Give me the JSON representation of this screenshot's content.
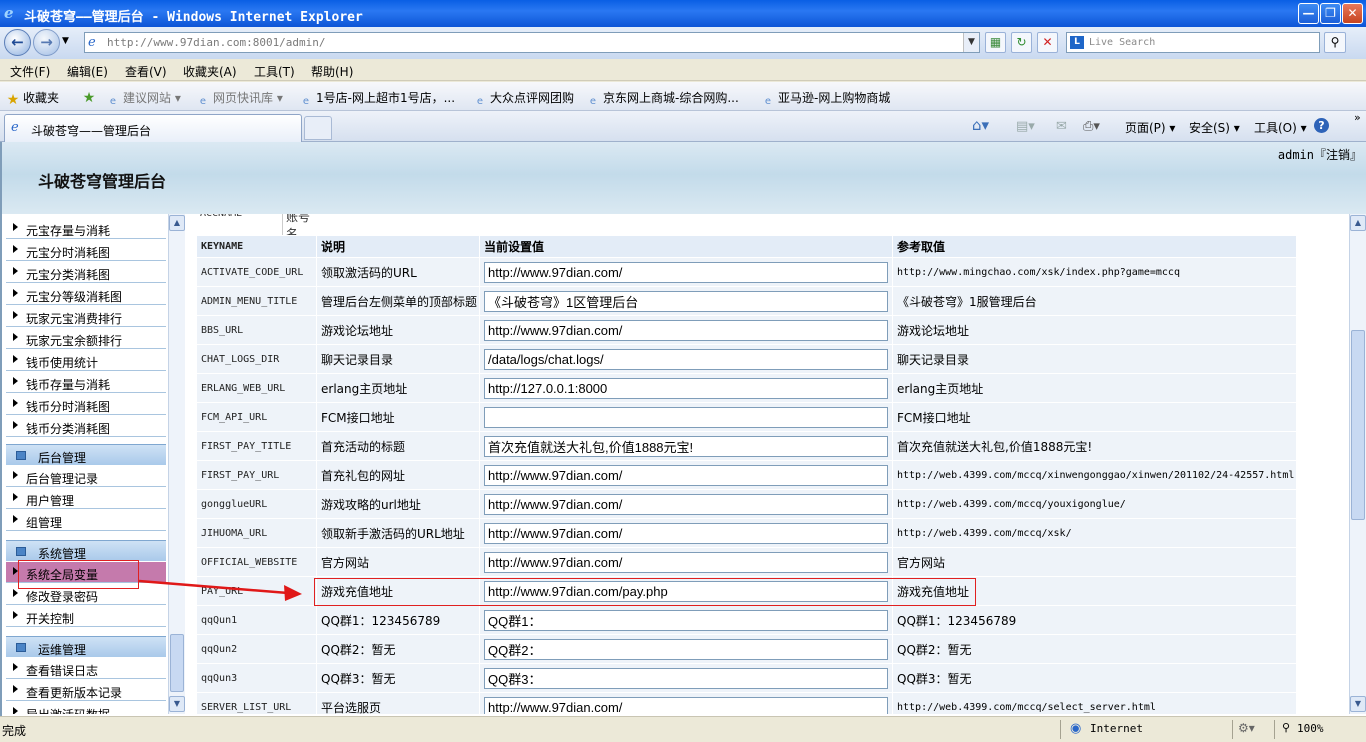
{
  "window": {
    "title": "斗破苍穹——管理后台 - Windows Internet Explorer"
  },
  "address_bar": {
    "url": "http://www.97dian.com:8001/admin/",
    "search_placeholder": "Live Search"
  },
  "menu": [
    "文件(F)",
    "编辑(E)",
    "查看(V)",
    "收藏夹(A)",
    "工具(T)",
    "帮助(H)"
  ],
  "favorites": {
    "label": "收藏夹",
    "items": [
      "建议网站 ▾",
      "网页快讯库 ▾",
      "1号店-网上超市1号店，...",
      "大众点评网团购",
      "京东网上商城-综合网购...",
      "亚马逊-网上购物商城"
    ]
  },
  "tab": {
    "title": "斗破苍穹——管理后台"
  },
  "command_bar": {
    "page": "页面(P) ▾",
    "safety": "安全(S) ▾",
    "tools": "工具(O) ▾"
  },
  "page": {
    "user": "admin『注销』",
    "title": "斗破苍穹管理后台"
  },
  "left_menu": {
    "items_a": [
      "元宝存量与消耗",
      "元宝分时消耗图",
      "元宝分类消耗图",
      "元宝分等级消耗图",
      "玩家元宝消费排行",
      "玩家元宝余额排行",
      "钱币使用统计",
      "钱币存量与消耗",
      "钱币分时消耗图",
      "钱币分类消耗图"
    ],
    "group_backend": "后台管理",
    "items_b": [
      "后台管理记录",
      "用户管理",
      "组管理"
    ],
    "group_system": "系统管理",
    "items_c": [
      "系统全局变量",
      "修改登录密码",
      "开关控制"
    ],
    "group_ops": "运维管理",
    "items_d": [
      "查看错误日志",
      "查看更新版本记录",
      "导出激活码数据"
    ]
  },
  "table": {
    "prev_row": {
      "key": "ACCNAME",
      "desc": "账号名"
    },
    "headers": {
      "key": "KEYNAME",
      "desc": "说明",
      "value": "当前设置值",
      "ref": "参考取值"
    },
    "rows": [
      {
        "key": "ACTIVATE_CODE_URL",
        "desc": "领取激活码的URL",
        "value": "http://www.97dian.com/",
        "ref": "http://www.mingchao.com/xsk/index.php?game=mccq"
      },
      {
        "key": "ADMIN_MENU_TITLE",
        "desc": "管理后台左侧菜单的顶部标题",
        "value": "《斗破苍穹》1区管理后台",
        "ref": "《斗破苍穹》1服管理后台"
      },
      {
        "key": "BBS_URL",
        "desc": "游戏论坛地址",
        "value": "http://www.97dian.com/",
        "ref": "游戏论坛地址"
      },
      {
        "key": "CHAT_LOGS_DIR",
        "desc": "聊天记录目录",
        "value": "/data/logs/chat.logs/",
        "ref": "聊天记录目录"
      },
      {
        "key": "ERLANG_WEB_URL",
        "desc": "erlang主页地址",
        "value": "http://127.0.0.1:8000",
        "ref": "erlang主页地址"
      },
      {
        "key": "FCM_API_URL",
        "desc": "FCM接口地址",
        "value": "",
        "ref": "FCM接口地址"
      },
      {
        "key": "FIRST_PAY_TITLE",
        "desc": "首充活动的标题",
        "value": "首次充值就送大礼包,价值1888元宝!",
        "ref": "首次充值就送大礼包,价值1888元宝!"
      },
      {
        "key": "FIRST_PAY_URL",
        "desc": "首充礼包的网址",
        "value": "http://www.97dian.com/",
        "ref": "http://web.4399.com/mccq/xinwengonggao/xinwen/201102/24-42557.html"
      },
      {
        "key": "gongglueURL",
        "desc": "游戏攻略的url地址",
        "value": "http://www.97dian.com/",
        "ref": "http://web.4399.com/mccq/youxigonglue/"
      },
      {
        "key": "JIHUOMA_URL",
        "desc": "领取新手激活码的URL地址",
        "value": "http://www.97dian.com/",
        "ref": "http://web.4399.com/mccq/xsk/"
      },
      {
        "key": "OFFICIAL_WEBSITE",
        "desc": "官方网站",
        "value": "http://www.97dian.com/",
        "ref": "官方网站"
      },
      {
        "key": "PAY_URL",
        "desc": "游戏充值地址",
        "value": "http://www.97dian.com/pay.php",
        "ref": "游戏充值地址"
      },
      {
        "key": "qqQun1",
        "desc": "QQ群1：123456789",
        "value": "QQ群1：",
        "ref": "QQ群1：123456789"
      },
      {
        "key": "qqQun2",
        "desc": "QQ群2：暂无",
        "value": "QQ群2：",
        "ref": "QQ群2：暂无"
      },
      {
        "key": "qqQun3",
        "desc": "QQ群3：暂无",
        "value": "QQ群3：",
        "ref": "QQ群3：暂无"
      },
      {
        "key": "SERVER_LIST_URL",
        "desc": "平台选服页",
        "value": "http://www.97dian.com/",
        "ref": "http://web.4399.com/mccq/select_server.html"
      }
    ]
  },
  "status_bar": {
    "text": "完成",
    "zone": "Internet",
    "zoom": "100%"
  }
}
